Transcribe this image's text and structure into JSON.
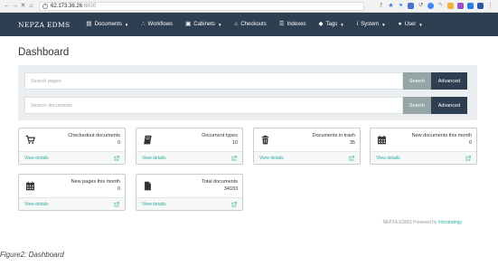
{
  "browser": {
    "url_host": "62.173.36.26",
    "url_port": ":8000"
  },
  "navbar": {
    "brand": "NEPZA EDMS",
    "items": [
      {
        "label": "Documents",
        "icon": "document-icon",
        "caret": true
      },
      {
        "label": "Workflows",
        "icon": "workflow-icon",
        "caret": false
      },
      {
        "label": "Cabinets",
        "icon": "cabinet-icon",
        "caret": true
      },
      {
        "label": "Checkouts",
        "icon": "cart-icon",
        "caret": false
      },
      {
        "label": "Indexes",
        "icon": "list-icon",
        "caret": false
      },
      {
        "label": "Tags",
        "icon": "tag-icon",
        "caret": true
      },
      {
        "label": "System",
        "icon": "info-icon",
        "caret": true
      },
      {
        "label": "User",
        "icon": "user-icon",
        "caret": true
      }
    ]
  },
  "page": {
    "title": "Dashboard"
  },
  "search": {
    "pages_placeholder": "Search pages",
    "documents_placeholder": "Search documents",
    "search_label": "Search",
    "advanced_label": "Advanced"
  },
  "cards": [
    {
      "title": "Checkedout documents",
      "value": "0",
      "icon": "cart-icon",
      "link": "View details"
    },
    {
      "title": "Document types",
      "value": "10",
      "icon": "book-icon",
      "link": "View details"
    },
    {
      "title": "Documents in trash",
      "value": "35",
      "icon": "trash-icon",
      "link": "View details"
    },
    {
      "title": "New documents this month",
      "value": "0",
      "icon": "calendar-icon",
      "link": "View details"
    },
    {
      "title": "New pages this month",
      "value": "0",
      "icon": "calendar-icon",
      "link": "View details"
    },
    {
      "title": "Total documents",
      "value": "34033",
      "icon": "file-icon",
      "link": "View details"
    }
  ],
  "footer": {
    "text": "NEPZA EDMS Powered by",
    "brand": "Infostrategy"
  },
  "caption": "Figure2: Dashboard",
  "colors": {
    "navbar": "#2e3f52",
    "accent": "#2cae9f",
    "search_button": "#95a5a6"
  }
}
